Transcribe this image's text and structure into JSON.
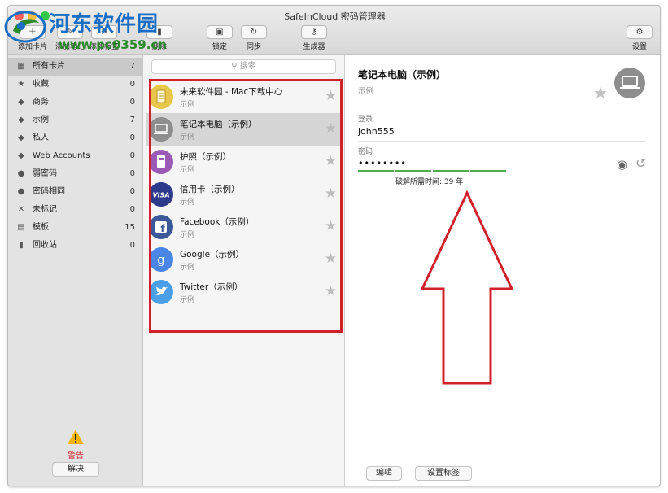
{
  "window": {
    "title": "SafeInCloud 密码管理器"
  },
  "watermark": {
    "site_name": "河东软件园",
    "url": "www.pc0359.cn"
  },
  "toolbar": {
    "add_card": "添加卡片",
    "add_note": "添加笔记",
    "add_label": "添加标签",
    "delete": "删除",
    "lock": "锁定",
    "sync": "同步",
    "generator": "生成器",
    "settings": "设置"
  },
  "sidebar": {
    "items": [
      {
        "label": "所有卡片",
        "count": "7",
        "icon": "grid-icon"
      },
      {
        "label": "收藏",
        "count": "0",
        "icon": "star-icon"
      },
      {
        "label": "商务",
        "count": "0",
        "icon": "tag-icon"
      },
      {
        "label": "示例",
        "count": "7",
        "icon": "tag-icon"
      },
      {
        "label": "私人",
        "count": "0",
        "icon": "tag-icon"
      },
      {
        "label": "Web Accounts",
        "count": "0",
        "icon": "tag-icon"
      },
      {
        "label": "弱密码",
        "count": "0",
        "icon": "alert-icon"
      },
      {
        "label": "密码相同",
        "count": "0",
        "icon": "alert-icon"
      },
      {
        "label": "未标记",
        "count": "0",
        "icon": "untagged-icon"
      },
      {
        "label": "模板",
        "count": "15",
        "icon": "template-icon"
      },
      {
        "label": "回收站",
        "count": "0",
        "icon": "trash-icon"
      }
    ],
    "warning_label": "警告",
    "resolve_label": "解决"
  },
  "search": {
    "placeholder": "搜索"
  },
  "cards": [
    {
      "title": "未来软件园 - Mac下载中心",
      "subtitle": "示例",
      "icon": "document-icon",
      "color": "#e8c64a"
    },
    {
      "title": "笔记本电脑（示例）",
      "subtitle": "示例",
      "icon": "laptop-icon",
      "color": "#8e8e8e"
    },
    {
      "title": "护照（示例）",
      "subtitle": "示例",
      "icon": "passport-icon",
      "color": "#9b59b6"
    },
    {
      "title": "信用卡（示例）",
      "subtitle": "示例",
      "icon": "visa-icon",
      "color": "#2d3a8c"
    },
    {
      "title": "Facebook（示例）",
      "subtitle": "示例",
      "icon": "facebook-icon",
      "color": "#3b5998"
    },
    {
      "title": "Google（示例）",
      "subtitle": "示例",
      "icon": "google-icon",
      "color": "#4a86e8"
    },
    {
      "title": "Twitter（示例）",
      "subtitle": "示例",
      "icon": "twitter-icon",
      "color": "#4a9fe8"
    }
  ],
  "detail": {
    "title": "笔记本电脑（示例）",
    "subtitle": "示例",
    "login_label": "登录",
    "login_value": "john555",
    "password_label": "密码",
    "password_value": "••••••••",
    "crack_time": "破解所需时间:  39 年",
    "strength_segments_filled": 4,
    "edit_label": "编辑",
    "set_labels_label": "设置标签"
  },
  "colors": {
    "highlight_box": "#d0202a",
    "strength": "#4cae4c",
    "watermark": "#1a6fc4"
  }
}
